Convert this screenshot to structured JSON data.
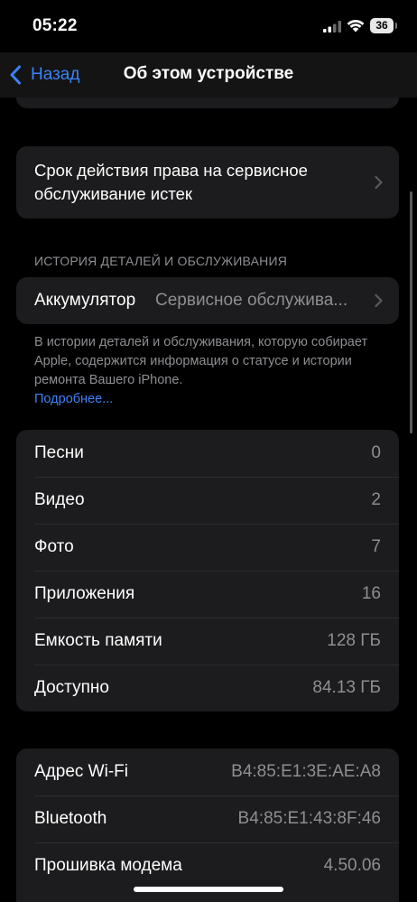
{
  "status_bar": {
    "time": "05:22",
    "battery_level": "36",
    "icons": [
      "signal-icon",
      "wifi-icon",
      "battery-icon"
    ]
  },
  "nav": {
    "back_label": "Назад",
    "title": "Об этом устройстве"
  },
  "service": {
    "label": "Срок действия права на сервисное обслуживание истек"
  },
  "history": {
    "header": "ИСТОРИЯ ДЕТАЛЕЙ И ОБСЛУЖИВАНИЯ",
    "battery_label": "Аккумулятор",
    "battery_value": "Сервисное обслужива...",
    "footnote": "В истории деталей и обслуживания, которую собирает Apple, содержится информация о статусе и истории ремонта Вашего iPhone.",
    "more_link": "Подробнее..."
  },
  "stats": [
    {
      "label": "Песни",
      "value": "0"
    },
    {
      "label": "Видео",
      "value": "2"
    },
    {
      "label": "Фото",
      "value": "7"
    },
    {
      "label": "Приложения",
      "value": "16"
    },
    {
      "label": "Емкость памяти",
      "value": "128 ГБ"
    },
    {
      "label": "Доступно",
      "value": "84.13 ГБ"
    }
  ],
  "network": [
    {
      "label": "Адрес Wi-Fi",
      "value": "B4:85:E1:3E:AE:A8"
    },
    {
      "label": "Bluetooth",
      "value": "B4:85:E1:43:8F:46"
    },
    {
      "label": "Прошивка модема",
      "value": "4.50.06"
    }
  ],
  "colors": {
    "background": "#000000",
    "card": "#1c1c1e",
    "accent": "#3b82f6",
    "secondary_text": "#8e8e93"
  }
}
